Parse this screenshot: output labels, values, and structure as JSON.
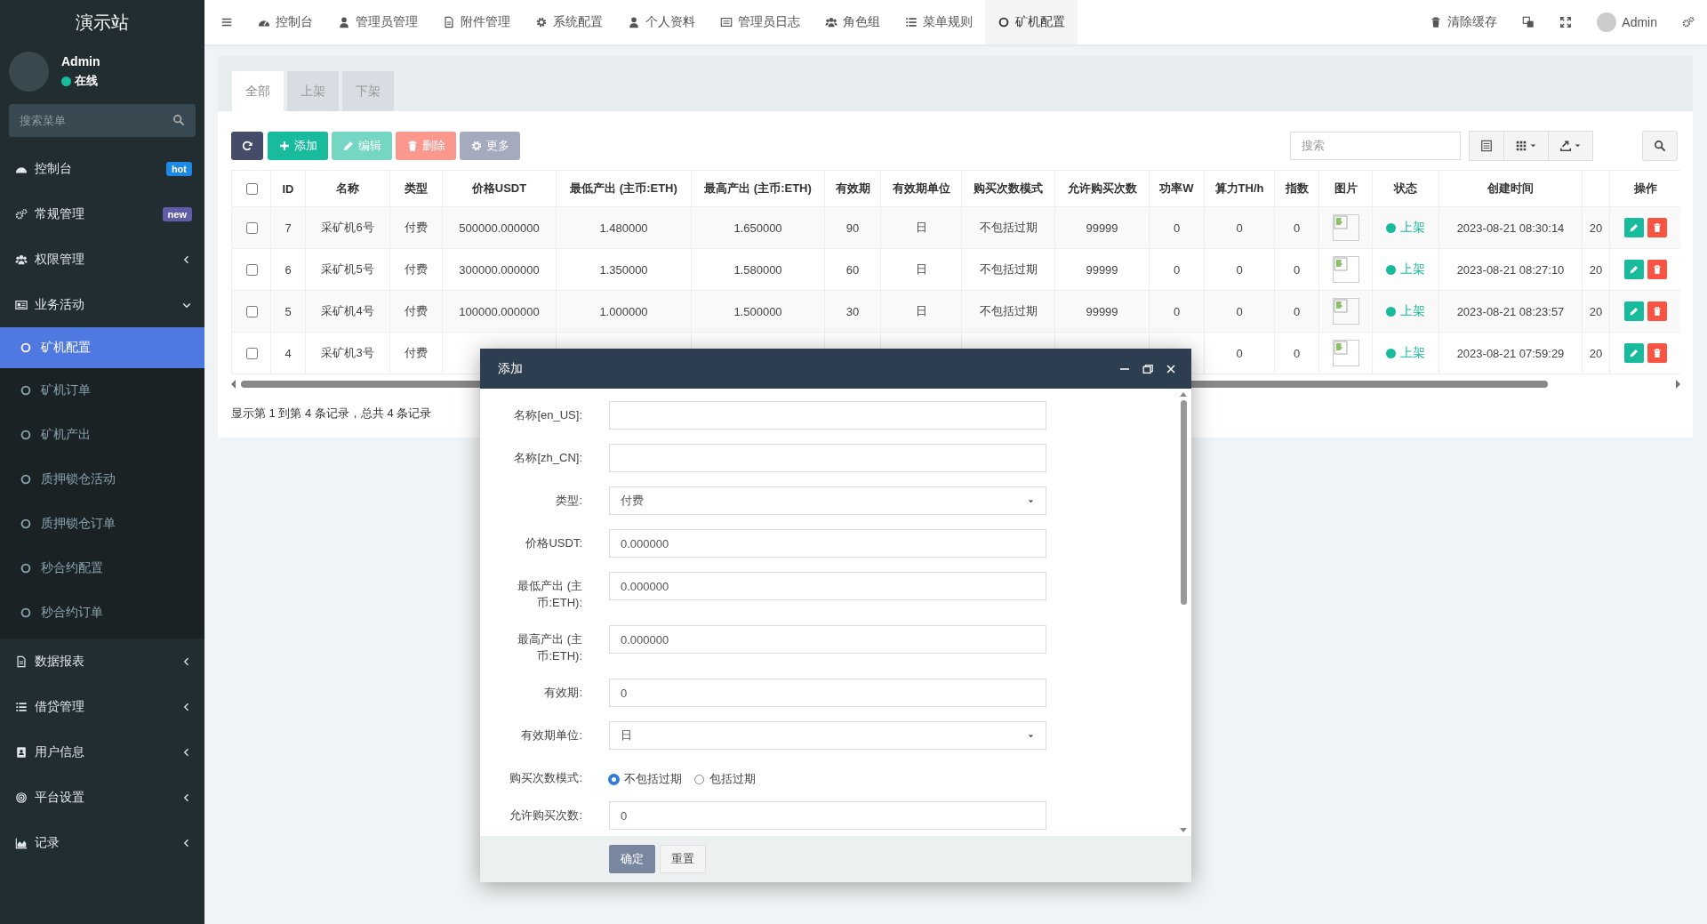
{
  "brand": "演示站",
  "user": {
    "name": "Admin",
    "status": "在线"
  },
  "sidebar": {
    "search_placeholder": "搜索菜单",
    "items": [
      {
        "label": "控制台",
        "badge": {
          "text": "hot",
          "color": "#1e88e5"
        }
      },
      {
        "label": "常规管理",
        "badge": {
          "text": "new",
          "color": "#605ca8"
        }
      },
      {
        "label": "权限管理",
        "expanded": false
      },
      {
        "label": "业务活动",
        "expanded": true,
        "children": [
          {
            "label": "矿机配置",
            "selected": true
          },
          {
            "label": "矿机订单",
            "selected": false
          },
          {
            "label": "矿机产出",
            "selected": false
          },
          {
            "label": "质押锁仓活动",
            "selected": false
          },
          {
            "label": "质押锁仓订单",
            "selected": false
          },
          {
            "label": "秒合约配置",
            "selected": false
          },
          {
            "label": "秒合约订单",
            "selected": false
          }
        ]
      },
      {
        "label": "数据报表",
        "expanded": false
      },
      {
        "label": "借贷管理",
        "expanded": false
      },
      {
        "label": "用户信息",
        "expanded": false
      },
      {
        "label": "平台设置",
        "expanded": false
      },
      {
        "label": "记录",
        "expanded": false
      }
    ]
  },
  "top_nav": {
    "tabs": [
      {
        "label": "控制台",
        "selected": false
      },
      {
        "label": "管理员管理",
        "selected": false
      },
      {
        "label": "附件管理",
        "selected": false
      },
      {
        "label": "系统配置",
        "selected": false
      },
      {
        "label": "个人资料",
        "selected": false
      },
      {
        "label": "管理员日志",
        "selected": false
      },
      {
        "label": "角色组",
        "selected": false
      },
      {
        "label": "菜单规则",
        "selected": false
      },
      {
        "label": "矿机配置",
        "selected": true
      }
    ],
    "clear_cache": "清除缓存",
    "user_name": "Admin"
  },
  "filter_tabs": [
    {
      "label": "全部",
      "selected": true
    },
    {
      "label": "上架",
      "selected": false
    },
    {
      "label": "下架",
      "selected": false
    }
  ],
  "toolbar": {
    "buttons": [
      {
        "label": "添加",
        "disabled": false
      },
      {
        "label": "编辑",
        "disabled": true
      },
      {
        "label": "删除",
        "disabled": true
      },
      {
        "label": "更多",
        "disabled": true
      }
    ],
    "search_placeholder": "搜索"
  },
  "table": {
    "select_all_checked": false,
    "headers": {
      "id": "ID",
      "name": "名称",
      "type": "类型",
      "price": "价格USDT",
      "min_output": "最低产出 (主币:ETH)",
      "max_output": "最高产出 (主币:ETH)",
      "validity": "有效期",
      "validity_unit": "有效期单位",
      "purchase_mode": "购买次数模式",
      "purchase_limit": "允许购买次数",
      "power": "功率W",
      "hashrate": "算力TH/h",
      "index": "指数",
      "image": "图片",
      "status": "状态",
      "created": "创建时间",
      "actions": "操作"
    },
    "rows": [
      {
        "checked": false,
        "id": "7",
        "name": "采矿机6号",
        "type": "付费",
        "price": "500000.000000",
        "min_output": "1.480000",
        "max_output": "1.650000",
        "validity": "90",
        "validity_unit": "日",
        "purchase_mode": "不包括过期",
        "purchase_limit": "99999",
        "power": "0",
        "hashrate": "0",
        "index": "0",
        "status": "上架",
        "created": "2023-08-21 08:30:14",
        "column_18": "20"
      },
      {
        "checked": false,
        "id": "6",
        "name": "采矿机5号",
        "type": "付费",
        "price": "300000.000000",
        "min_output": "1.350000",
        "max_output": "1.580000",
        "validity": "60",
        "validity_unit": "日",
        "purchase_mode": "不包括过期",
        "purchase_limit": "99999",
        "power": "0",
        "hashrate": "0",
        "index": "0",
        "status": "上架",
        "created": "2023-08-21 08:27:10",
        "column_18": "20"
      },
      {
        "checked": false,
        "id": "5",
        "name": "采矿机4号",
        "type": "付费",
        "price": "100000.000000",
        "min_output": "1.000000",
        "max_output": "1.500000",
        "validity": "30",
        "validity_unit": "日",
        "purchase_mode": "不包括过期",
        "purchase_limit": "99999",
        "power": "0",
        "hashrate": "0",
        "index": "0",
        "status": "上架",
        "created": "2023-08-21 08:23:57",
        "column_18": "20"
      },
      {
        "checked": false,
        "id": "4",
        "name": "采矿机3号",
        "type": "付费",
        "hashrate": "0",
        "index": "0",
        "status": "上架",
        "created": "2023-08-21 07:59:29",
        "column_18": "20"
      }
    ],
    "summary": "显示第 1 到第 4 条记录，总共 4 条记录"
  },
  "dialog": {
    "title": "添加",
    "fields": [
      {
        "kind": "text",
        "label": "名称[en_US]:"
      },
      {
        "kind": "text",
        "label": "名称[zh_CN]:"
      },
      {
        "kind": "select",
        "label": "类型:",
        "value": "付费"
      },
      {
        "kind": "text",
        "label": "价格USDT:",
        "value": "0.000000"
      },
      {
        "kind": "text",
        "label": "最低产出 (主币:ETH):",
        "value": "0.000000"
      },
      {
        "kind": "text",
        "label": "最高产出 (主币:ETH):",
        "value": "0.000000"
      },
      {
        "kind": "text",
        "label": "有效期:",
        "value": "0"
      },
      {
        "kind": "select",
        "label": "有效期单位:",
        "value": "日"
      },
      {
        "kind": "radio",
        "label": "购买次数模式:",
        "options": [
          {
            "label": "不包括过期",
            "selected": true
          },
          {
            "label": "包括过期",
            "selected": false
          }
        ]
      },
      {
        "kind": "text",
        "label": "允许购买次数:",
        "value": "0"
      }
    ],
    "buttons": [
      {
        "kind": "primary",
        "label": "确定"
      },
      {
        "kind": "default",
        "label": "重置"
      }
    ]
  }
}
